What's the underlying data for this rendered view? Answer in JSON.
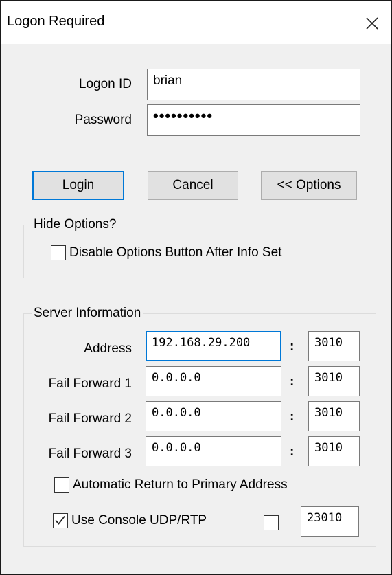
{
  "window": {
    "title": "Logon Required"
  },
  "credentials": {
    "logon_id_label": "Logon ID",
    "logon_id_value": "brian",
    "password_label": "Password",
    "password_mask": "••••••••••"
  },
  "buttons": {
    "login": "Login",
    "cancel": "Cancel",
    "options": "<< Options"
  },
  "hide_options": {
    "group_title": "Hide Options?",
    "disable_checkbox_label": "Disable Options Button After Info Set",
    "disable_checked": false
  },
  "server": {
    "group_title": "Server Information",
    "rows": [
      {
        "label": "Address",
        "address": "192.168.29.200",
        "port": "3010"
      },
      {
        "label": "Fail Forward 1",
        "address": "0.0.0.0",
        "port": "3010"
      },
      {
        "label": "Fail Forward 2",
        "address": "0.0.0.0",
        "port": "3010"
      },
      {
        "label": "Fail Forward 3",
        "address": "0.0.0.0",
        "port": "3010"
      }
    ],
    "colon": ":",
    "auto_return_label": "Automatic Return to Primary Address",
    "auto_return_checked": false,
    "udp_label": "Use Console UDP/RTP",
    "udp_checked": true,
    "udp_extra_checked": false,
    "udp_port": "23010"
  },
  "icons": {
    "close": "close-icon",
    "checkmark": "checkmark-icon"
  },
  "colors": {
    "focus_border": "#0078d7",
    "dialog_bg": "#f0f0f0"
  }
}
